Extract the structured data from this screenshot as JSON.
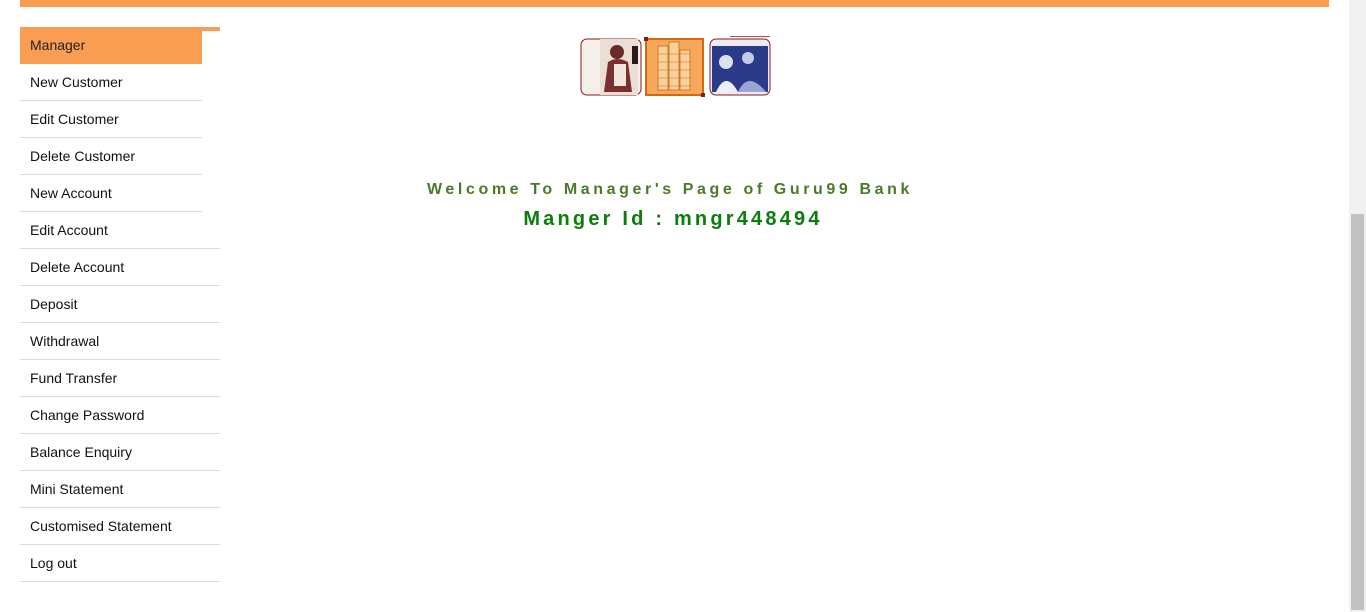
{
  "sidebar": {
    "items": [
      {
        "label": "Manager",
        "active": true
      },
      {
        "label": "New Customer"
      },
      {
        "label": "Edit Customer"
      },
      {
        "label": "Delete Customer"
      },
      {
        "label": "New Account"
      },
      {
        "label": "Edit Account"
      },
      {
        "label": "Delete Account"
      },
      {
        "label": "Deposit"
      },
      {
        "label": "Withdrawal"
      },
      {
        "label": "Fund Transfer"
      },
      {
        "label": "Change Password"
      },
      {
        "label": "Balance Enquiry"
      },
      {
        "label": "Mini Statement"
      },
      {
        "label": "Customised Statement"
      },
      {
        "label": "Log out"
      }
    ]
  },
  "main": {
    "welcome_text": "Welcome To Manager's Page of Guru99 Bank",
    "manager_id_text": "Manger Id : mngr448494"
  },
  "colors": {
    "accent": "#f99d52",
    "welcome": "#4b7a2a",
    "manager_id": "#0b7d0b"
  },
  "icons": {
    "banner": "bank-banner-image"
  }
}
